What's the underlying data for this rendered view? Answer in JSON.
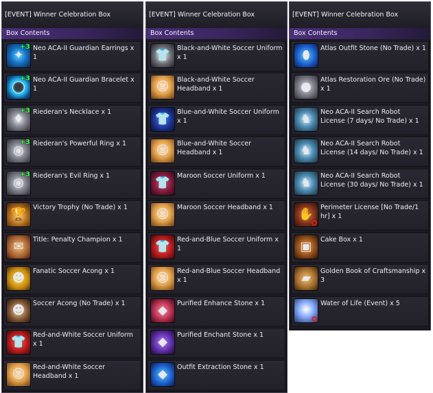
{
  "panels": [
    {
      "title": "[EVENT] Winner Celebration Box",
      "section": "Box Contents",
      "items": [
        {
          "label": "Neo ACA-II Guardian Earrings x 1",
          "icon": "earrings-icon",
          "theme": "t-blue",
          "glyph": "✦",
          "plus": "+3",
          "ban": false
        },
        {
          "label": "Neo ACA-II Guardian Bracelet x 1",
          "icon": "bracelet-icon",
          "theme": "t-cyan",
          "glyph": "◯",
          "plus": "+3",
          "ban": false
        },
        {
          "label": "Riederan's Necklace x 1",
          "icon": "necklace-icon",
          "theme": "t-silver",
          "glyph": "♦",
          "plus": "+3",
          "ban": false
        },
        {
          "label": "Riederan's Powerful Ring x 1",
          "icon": "ring-icon",
          "theme": "t-silver",
          "glyph": "◎",
          "plus": "+3",
          "ban": false
        },
        {
          "label": "Riederan's Evil Ring x 1",
          "icon": "ring-icon",
          "theme": "t-silver",
          "glyph": "◎",
          "plus": "+3",
          "ban": false
        },
        {
          "label": "Victory Trophy (No Trade) x 1",
          "icon": "trophy-icon",
          "theme": "t-gold",
          "glyph": "🏆",
          "plus": "",
          "ban": false
        },
        {
          "label": "Title: Penalty Champion x 1",
          "icon": "scroll-icon",
          "theme": "t-paper",
          "glyph": "✉",
          "plus": "",
          "ban": false
        },
        {
          "label": "Fanatic Soccer Acong x 1",
          "icon": "acong-pet-icon",
          "theme": "t-yellow",
          "glyph": "☻",
          "plus": "",
          "ban": false
        },
        {
          "label": "Soccer Acong (No Trade) x 1",
          "icon": "acong-pet-icon",
          "theme": "t-brown",
          "glyph": "☻",
          "plus": "",
          "ban": false
        },
        {
          "label": "Red-and-White Soccer Uniform x 1",
          "icon": "uniform-icon",
          "theme": "t-red",
          "glyph": "👕",
          "plus": "",
          "ban": false
        },
        {
          "label": "Red-and-White Soccer Headband x 1",
          "icon": "headband-icon",
          "theme": "t-hair",
          "glyph": "☺",
          "plus": "",
          "ban": false
        }
      ]
    },
    {
      "title": "[EVENT] Winner Celebration Box",
      "section": "Box Contents",
      "items": [
        {
          "label": "Black-and-White Soccer Uniform x 1",
          "icon": "uniform-icon",
          "theme": "t-bw",
          "glyph": "👕",
          "plus": "",
          "ban": false
        },
        {
          "label": "Black-and-White Soccer Headband x 1",
          "icon": "headband-icon",
          "theme": "t-hair",
          "glyph": "☺",
          "plus": "",
          "ban": false
        },
        {
          "label": "Blue-and-White Soccer Uniform x 1",
          "icon": "uniform-icon",
          "theme": "t-navy",
          "glyph": "👕",
          "plus": "",
          "ban": false
        },
        {
          "label": "Blue-and-White Soccer Headband x 1",
          "icon": "headband-icon",
          "theme": "t-hair",
          "glyph": "☺",
          "plus": "",
          "ban": false
        },
        {
          "label": "Maroon Soccer Uniform x 1",
          "icon": "uniform-icon",
          "theme": "t-maroon",
          "glyph": "👕",
          "plus": "",
          "ban": false
        },
        {
          "label": "Maroon Soccer Headband x 1",
          "icon": "headband-icon",
          "theme": "t-hair",
          "glyph": "☺",
          "plus": "",
          "ban": false
        },
        {
          "label": "Red-and-Blue Soccer Uniform x 1",
          "icon": "uniform-icon",
          "theme": "t-red",
          "glyph": "👕",
          "plus": "",
          "ban": false
        },
        {
          "label": "Red-and-Blue Soccer Headband x 1",
          "icon": "headband-icon",
          "theme": "t-hair",
          "glyph": "☺",
          "plus": "",
          "ban": false
        },
        {
          "label": "Purified Enhance Stone x 1",
          "icon": "enhance-stone-icon",
          "theme": "t-pink",
          "glyph": "◆",
          "plus": "",
          "ban": false
        },
        {
          "label": "Purified Enchant Stone x 1",
          "icon": "enchant-stone-icon",
          "theme": "t-violet",
          "glyph": "◆",
          "plus": "",
          "ban": false
        },
        {
          "label": "Outfit Extraction Stone x 1",
          "icon": "extraction-stone-icon",
          "theme": "t-azure",
          "glyph": "◆",
          "plus": "",
          "ban": false
        }
      ]
    },
    {
      "title": "[EVENT] Winner Celebration Box",
      "section": "Box Contents",
      "items": [
        {
          "label": "Atlas Outfit Stone (No Trade) x 1",
          "icon": "outfit-stone-icon",
          "theme": "t-azure",
          "glyph": "⬮",
          "plus": "",
          "ban": false
        },
        {
          "label": "Atlas Restoration Ore (No Trade) x 1",
          "icon": "ore-icon",
          "theme": "t-silver",
          "glyph": "●",
          "plus": "",
          "ban": false
        },
        {
          "label": "Neo ACA-II Search Robot License (7 days/ No Trade) x 1",
          "icon": "robot-license-icon",
          "theme": "t-robot",
          "glyph": "♞",
          "plus": "",
          "ban": false
        },
        {
          "label": "Neo ACA-II Search Robot License (14 days/ No Trade) x 1",
          "icon": "robot-license-icon",
          "theme": "t-robot",
          "glyph": "♞",
          "plus": "",
          "ban": false
        },
        {
          "label": "Neo ACA-II Search Robot License (30 days/ No Trade) x 1",
          "icon": "robot-license-icon",
          "theme": "t-robot",
          "glyph": "♞",
          "plus": "",
          "ban": false
        },
        {
          "label": "Perimeter License [No Trade/1 hr] x 1",
          "icon": "perimeter-license-icon",
          "theme": "t-leather",
          "glyph": "✋",
          "plus": "",
          "ban": true
        },
        {
          "label": "Cake Box x 1",
          "icon": "cake-box-icon",
          "theme": "t-cake",
          "glyph": "▣",
          "plus": "",
          "ban": false
        },
        {
          "label": "Golden Book of Craftsmanship x 3",
          "icon": "book-icon",
          "theme": "t-book",
          "glyph": "▰",
          "plus": "",
          "ban": false
        },
        {
          "label": "Water of Life (Event) x 5",
          "icon": "water-of-life-icon",
          "theme": "t-water",
          "glyph": "✧",
          "plus": "",
          "ban": true
        }
      ]
    }
  ]
}
